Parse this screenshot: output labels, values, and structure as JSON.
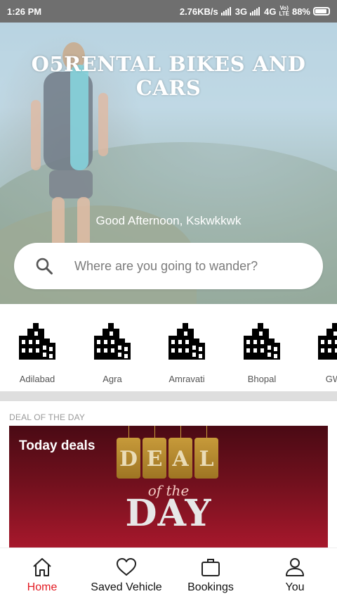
{
  "status_bar": {
    "time": "1:26 PM",
    "speed": "2.76KB/s",
    "net1": "3G",
    "net2": "4G",
    "volte_top": "Vo)",
    "volte_bottom": "LTE",
    "battery": "88%",
    "battery_level": 0.88
  },
  "hero": {
    "title": "O5RENTAL BIKES AND CARS",
    "greeting": "Good Afternoon, Kskwkkwk",
    "search_placeholder": "Where are you going to wander?"
  },
  "cities": [
    {
      "label": "Adilabad",
      "icon": "building-icon"
    },
    {
      "label": "Agra",
      "icon": "building-icon"
    },
    {
      "label": "Amravati",
      "icon": "building-icon"
    },
    {
      "label": "Bhopal",
      "icon": "building-icon"
    },
    {
      "label": "GWA",
      "icon": "building-icon"
    }
  ],
  "deal": {
    "section_title": "DEAL OF THE DAY",
    "card_title": "Today deals",
    "tag_letters": [
      "D",
      "E",
      "A",
      "L"
    ],
    "of_the": "of the",
    "day": "DAY"
  },
  "nav": {
    "active_color": "#e31b23",
    "items": [
      {
        "label": "Home",
        "icon": "home-icon",
        "active": true
      },
      {
        "label": "Saved Vehicle",
        "icon": "heart-icon",
        "active": false
      },
      {
        "label": "Bookings",
        "icon": "briefcase-icon",
        "active": false
      },
      {
        "label": "You",
        "icon": "user-icon",
        "active": false
      }
    ]
  }
}
